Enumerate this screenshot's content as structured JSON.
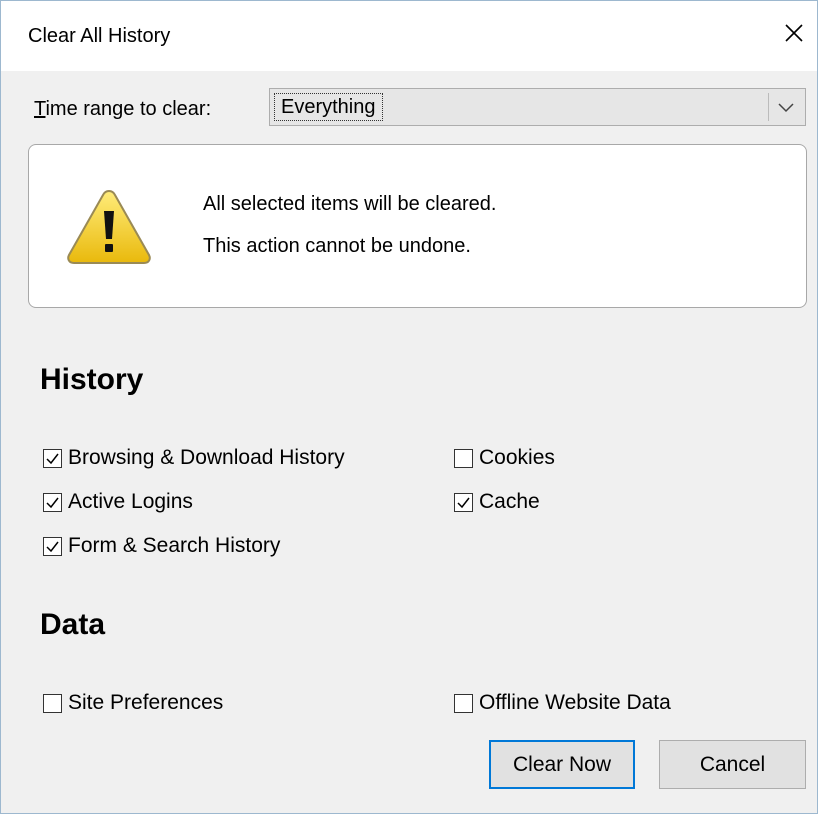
{
  "window": {
    "title": "Clear All History",
    "close_icon": "close-icon"
  },
  "time_range": {
    "label_first": "T",
    "label_rest": "ime range to clear:",
    "selected": "Everything",
    "dropdown_icon": "chevron-down-icon"
  },
  "warning": {
    "icon": "warning-icon",
    "line1": "All selected items will be cleared.",
    "line2": "This action cannot be undone."
  },
  "history": {
    "heading": "History",
    "items": [
      {
        "label": "Browsing & Download History",
        "checked": true
      },
      {
        "label": "Cookies",
        "checked": false
      },
      {
        "label": "Active Logins",
        "checked": true
      },
      {
        "label": "Cache",
        "checked": true
      },
      {
        "label": "Form & Search History",
        "checked": true
      }
    ]
  },
  "data_section": {
    "heading": "Data",
    "items": [
      {
        "label": "Site Preferences",
        "checked": false
      },
      {
        "label": "Offline Website Data",
        "checked": false
      }
    ]
  },
  "buttons": {
    "clear_now": "Clear Now",
    "cancel": "Cancel"
  }
}
